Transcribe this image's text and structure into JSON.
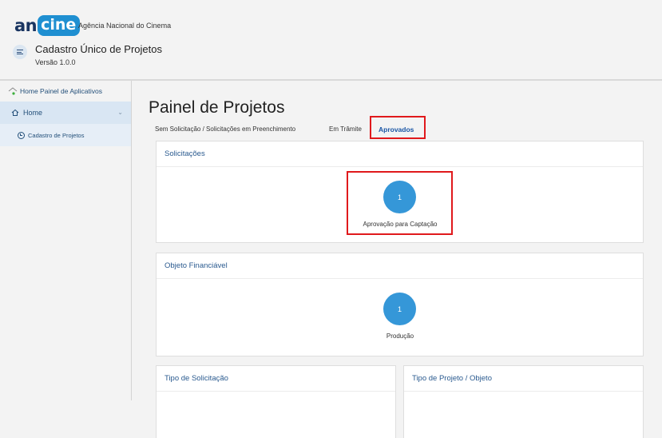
{
  "header": {
    "logo_an": "an",
    "logo_cine": "cine",
    "agency": "Agência Nacional do Cinema",
    "app_title": "Cadastro Único de Projetos",
    "app_version": "Versão 1.0.0"
  },
  "sidebar": {
    "home_panel": "Home Painel de Aplicativos",
    "home": "Home",
    "cadastro": "Cadastro de Projetos"
  },
  "main": {
    "title": "Painel de Projetos",
    "tabs": [
      {
        "label": "Sem Solicitação / Solicitações em Preenchimento"
      },
      {
        "label": "Em Trâmite"
      },
      {
        "label": "Aprovados"
      }
    ],
    "panels": {
      "solicitacoes": {
        "title": "Solicitações",
        "badge": "1",
        "label": "Aprovação para Captação"
      },
      "objeto": {
        "title": "Objeto Financiável",
        "badge": "1",
        "label": "Produção"
      },
      "tipo_solicitacao": {
        "title": "Tipo de Solicitação"
      },
      "tipo_projeto": {
        "title": "Tipo de Projeto / Objeto"
      }
    }
  },
  "colors": {
    "accent": "#3597d8",
    "highlight": "#e0191c",
    "active_tab": "#1a56a5"
  }
}
